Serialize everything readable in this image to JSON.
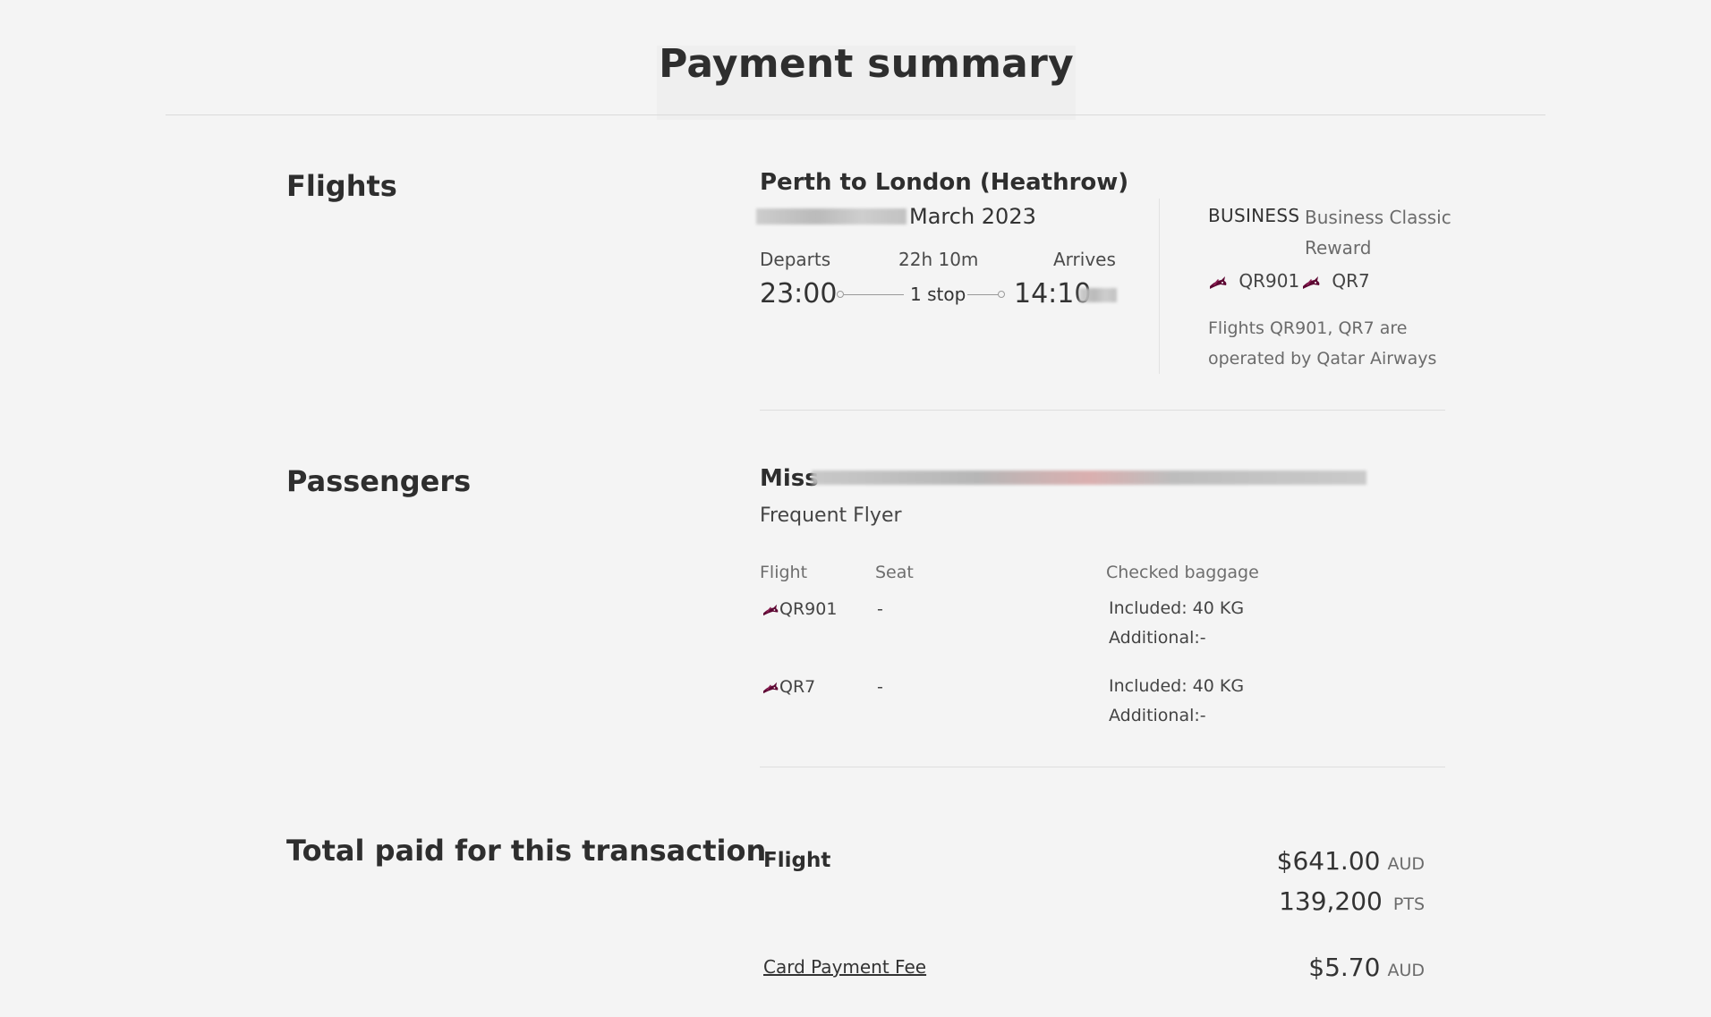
{
  "page": {
    "title": "Payment summary"
  },
  "flights": {
    "heading": "Flights",
    "route": "Perth to London (Heathrow)",
    "date_visible": "March 2023",
    "departs_label": "Departs",
    "duration": "22h 10m",
    "arrives_label": "Arrives",
    "depart_time": "23:00",
    "stops": "1 stop",
    "arrive_time": "14:10",
    "cabin": "BUSINESS",
    "fare_line1": "Business Classic",
    "fare_line2": "Reward",
    "flight_numbers": [
      "QR901",
      "QR7"
    ],
    "operated_line1": "Flights QR901, QR7 are",
    "operated_line2": "operated by Qatar Airways",
    "icon": "qatar-oryx-icon"
  },
  "passengers": {
    "heading": "Passengers",
    "title": "Miss",
    "type": "Frequent Flyer",
    "columns": {
      "flight": "Flight",
      "seat": "Seat",
      "baggage": "Checked baggage"
    },
    "rows": [
      {
        "flight": "QR901",
        "seat": "-",
        "included": "Included: 40 KG",
        "additional": "Additional:-"
      },
      {
        "flight": "QR7",
        "seat": "-",
        "included": "Included: 40 KG",
        "additional": "Additional:-"
      }
    ]
  },
  "totals": {
    "heading": "Total paid for this transaction",
    "flight_label": "Flight",
    "flight_amount": "$641.00",
    "flight_currency": "AUD",
    "points_amount": "139,200",
    "points_unit": "PTS",
    "fee_label": "Card Payment Fee",
    "fee_amount": "$5.70",
    "fee_currency": "AUD"
  },
  "colors": {
    "background": "#f4f4f4",
    "text": "#323232",
    "muted": "#6b6b6b",
    "oryx": "#5c0632",
    "rule": "#dedede"
  }
}
